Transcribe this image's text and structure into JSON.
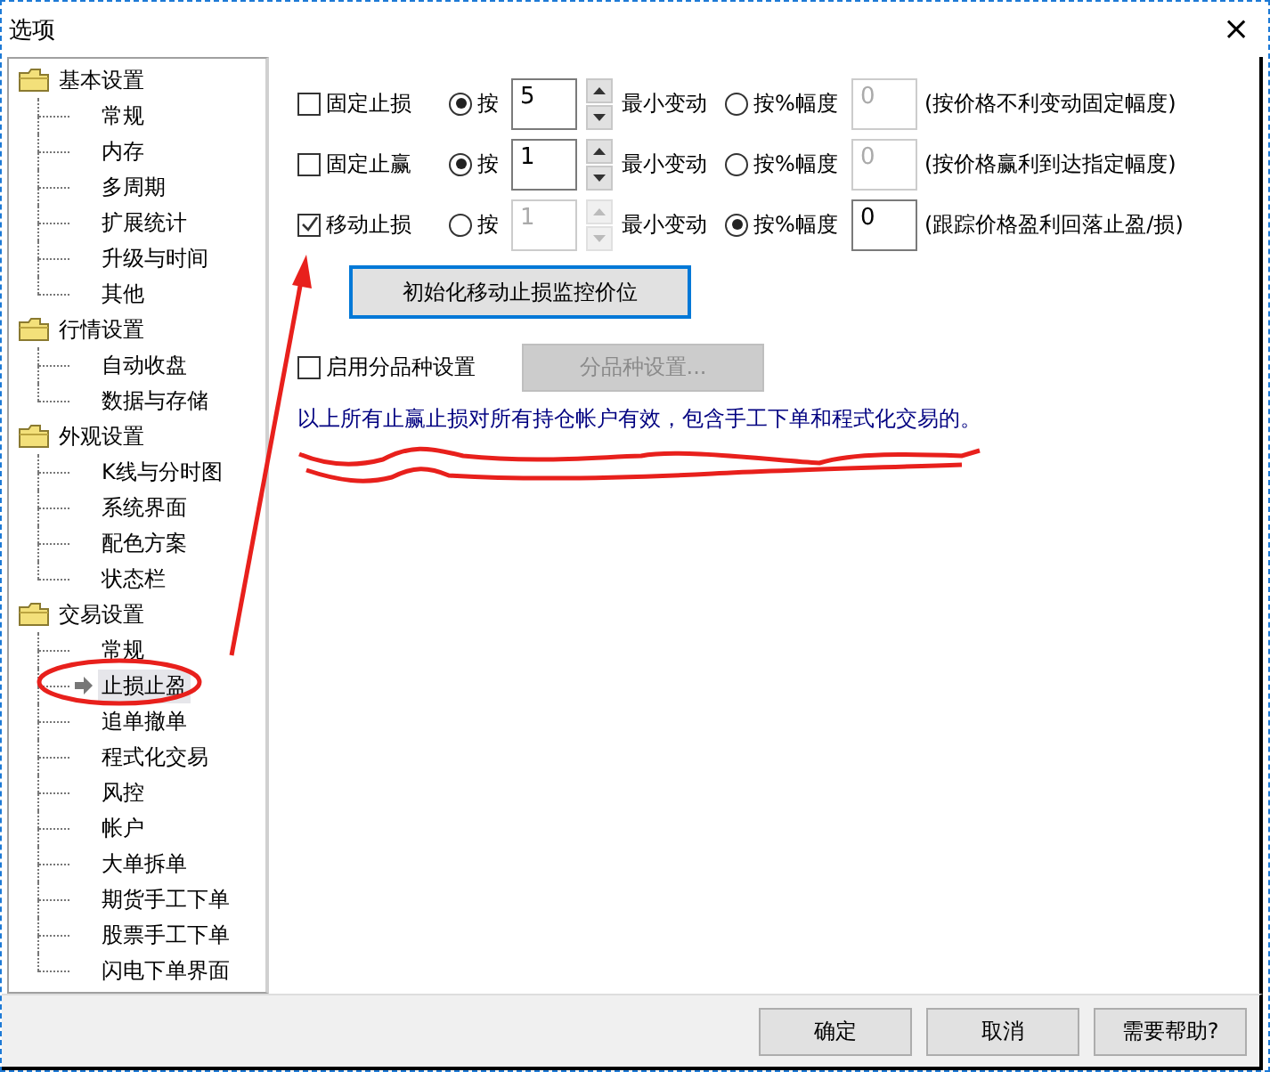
{
  "window": {
    "title": "选项",
    "close": "×"
  },
  "tree": [
    {
      "label": "基本设置",
      "children": [
        {
          "label": "常规",
          "selected": false
        },
        {
          "label": "内存",
          "selected": false
        },
        {
          "label": "多周期",
          "selected": false
        },
        {
          "label": "扩展统计",
          "selected": false
        },
        {
          "label": "升级与时间",
          "selected": false
        },
        {
          "label": "其他",
          "selected": false
        }
      ]
    },
    {
      "label": "行情设置",
      "children": [
        {
          "label": "自动收盘",
          "selected": false
        },
        {
          "label": "数据与存储",
          "selected": false
        }
      ]
    },
    {
      "label": "外观设置",
      "children": [
        {
          "label": "K线与分时图",
          "selected": false
        },
        {
          "label": "系统界面",
          "selected": false
        },
        {
          "label": "配色方案",
          "selected": false
        },
        {
          "label": "状态栏",
          "selected": false
        }
      ]
    },
    {
      "label": "交易设置",
      "children": [
        {
          "label": "常规",
          "selected": false
        },
        {
          "label": "止损止盈",
          "selected": true
        },
        {
          "label": "追单撤单",
          "selected": false
        },
        {
          "label": "程式化交易",
          "selected": false
        },
        {
          "label": "风控",
          "selected": false
        },
        {
          "label": "帐户",
          "selected": false
        },
        {
          "label": "大单拆单",
          "selected": false
        },
        {
          "label": "期货手工下单",
          "selected": false
        },
        {
          "label": "股票手工下单",
          "selected": false
        },
        {
          "label": "闪电下单界面",
          "selected": false
        }
      ]
    }
  ],
  "stop_rows": [
    {
      "label": "固定止损",
      "checked": false,
      "tick_option": {
        "label": "按",
        "selected": true
      },
      "tick_value": {
        "value": "5",
        "disabled": false
      },
      "tick_unit": "最小变动",
      "percent_option": {
        "label": "按%幅度",
        "selected": false
      },
      "percent_value": {
        "value": "0",
        "disabled": true
      },
      "note": "(按价格不利变动固定幅度)"
    },
    {
      "label": "固定止赢",
      "checked": false,
      "tick_option": {
        "label": "按",
        "selected": true
      },
      "tick_value": {
        "value": "1",
        "disabled": false
      },
      "tick_unit": "最小变动",
      "percent_option": {
        "label": "按%幅度",
        "selected": false
      },
      "percent_value": {
        "value": "0",
        "disabled": true
      },
      "note": "(按价格赢利到达指定幅度)"
    },
    {
      "label": "移动止损",
      "checked": true,
      "tick_option": {
        "label": "按",
        "selected": false
      },
      "tick_value": {
        "value": "1",
        "disabled": true
      },
      "tick_unit": "最小变动",
      "percent_option": {
        "label": "按%幅度",
        "selected": true
      },
      "percent_value": {
        "value": "0",
        "disabled": false
      },
      "note": "(跟踪价格盈利回落止盈/损)"
    }
  ],
  "init_button": {
    "label": "初始化移动止损监控价位",
    "focused": true
  },
  "variety": {
    "label": "启用分品种设置",
    "checked": false,
    "button": {
      "label": "分品种设置...",
      "disabled": true
    }
  },
  "notice": "以上所有止赢止损对所有持仓帐户有效，包含手工下单和程式化交易的。",
  "buttons": [
    "确定",
    "取消",
    "需要帮助?"
  ]
}
